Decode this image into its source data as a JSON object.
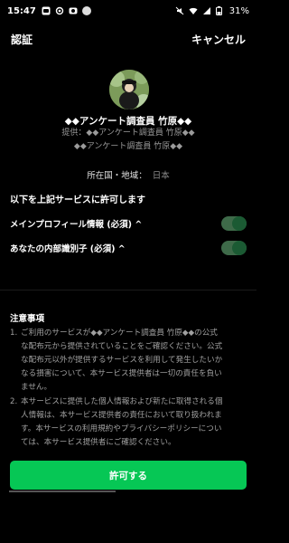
{
  "status_bar": {
    "time": "15:47",
    "battery": "31%",
    "left_icons": [
      "line-app-icon",
      "sync-icon",
      "camera-icon",
      "dots-icon"
    ],
    "right_icons": [
      "mute-icon",
      "wifi-icon",
      "signal-icon",
      "battery-icon"
    ]
  },
  "header": {
    "title": "認証",
    "cancel_label": "キャンセル"
  },
  "service": {
    "name": "◆◆アンケート調査員 竹原◆◆",
    "provider_line1": "提供：◆◆アンケート調査員 竹原◆◆",
    "provider_line2": "◆◆アンケート調査員 竹原◆◆"
  },
  "country": {
    "label": "所在国・地域：",
    "value": "日本"
  },
  "permissions": {
    "heading": "以下を上記サービスに許可します",
    "items": [
      {
        "label": "メインプロフィール情報 (必須) ^",
        "enabled": true
      },
      {
        "label": "あなたの内部識別子 (必須) ^",
        "enabled": true
      }
    ]
  },
  "notes": {
    "heading": "注意事項",
    "items": [
      {
        "num": "1.",
        "lines": [
          "ご利用のサービスが◆◆アンケート調査員 竹原◆◆の公式",
          "な配布元から提供されていることをご確認ください。公式",
          "な配布元以外が提供するサービスを利用して発生したいか",
          "なる損害について、本サービス提供者は一切の責任を負い",
          "ません。"
        ]
      },
      {
        "num": "2.",
        "lines": [
          "本サービスに提供した個人情報および新たに取得される個",
          "人情報は、本サービス提供者の責任において取り扱われま",
          "す。本サービスの利用規約やプライバシーポリシーについ",
          "ては、本サービス提供者にご確認ください。"
        ]
      }
    ]
  },
  "allow_button": {
    "label": "許可する"
  },
  "colors": {
    "accent": "#06c755",
    "background": "#000000",
    "toggle_track": "#3e6a49",
    "toggle_knob": "#1b5a33"
  }
}
